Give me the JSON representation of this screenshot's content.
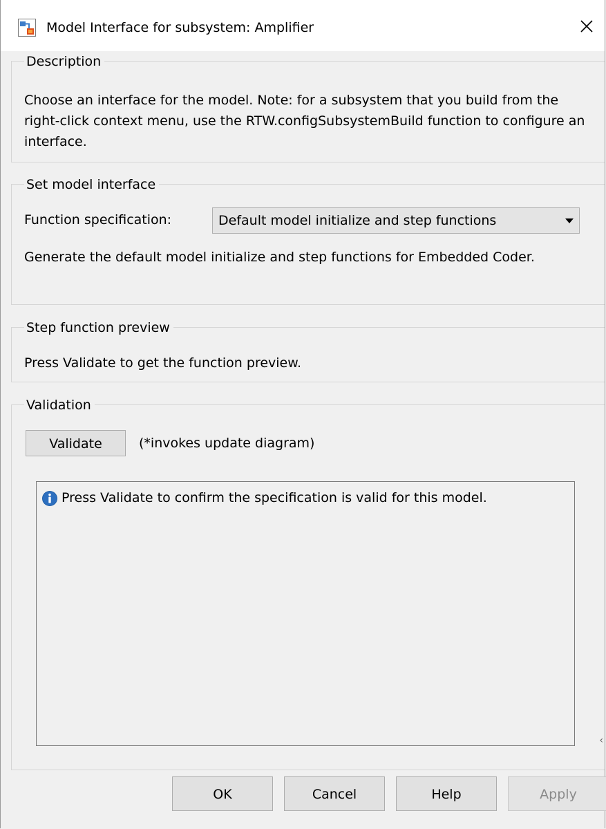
{
  "window": {
    "title": "Model Interface for subsystem: Amplifier",
    "close_glyph": "✕",
    "app_icon": "simulink-model-icon"
  },
  "description": {
    "title": "Description",
    "text": "Choose an interface for the model. Note: for a subsystem that you build from the right-click context menu, use the RTW.configSubsystemBuild function to configure an interface."
  },
  "model_interface": {
    "title": "Set model interface",
    "function_spec_label": "Function specification:",
    "function_spec_value": "Default model initialize and step functions",
    "help_text": "Generate the default model initialize and step functions for Embedded Coder."
  },
  "step_preview": {
    "title": "Step function preview",
    "text": "Press Validate to get the function preview."
  },
  "validation": {
    "title": "Validation",
    "validate_label": "Validate",
    "note": "(*invokes update diagram)",
    "message": "Press Validate to confirm the specification is valid for this model.",
    "info_icon": "info-icon",
    "info_color": "#1f5fa8"
  },
  "footer": {
    "ok_label": "OK",
    "cancel_label": "Cancel",
    "help_label": "Help",
    "apply_label": "Apply",
    "apply_enabled": false,
    "resize_glyph": "‹"
  }
}
